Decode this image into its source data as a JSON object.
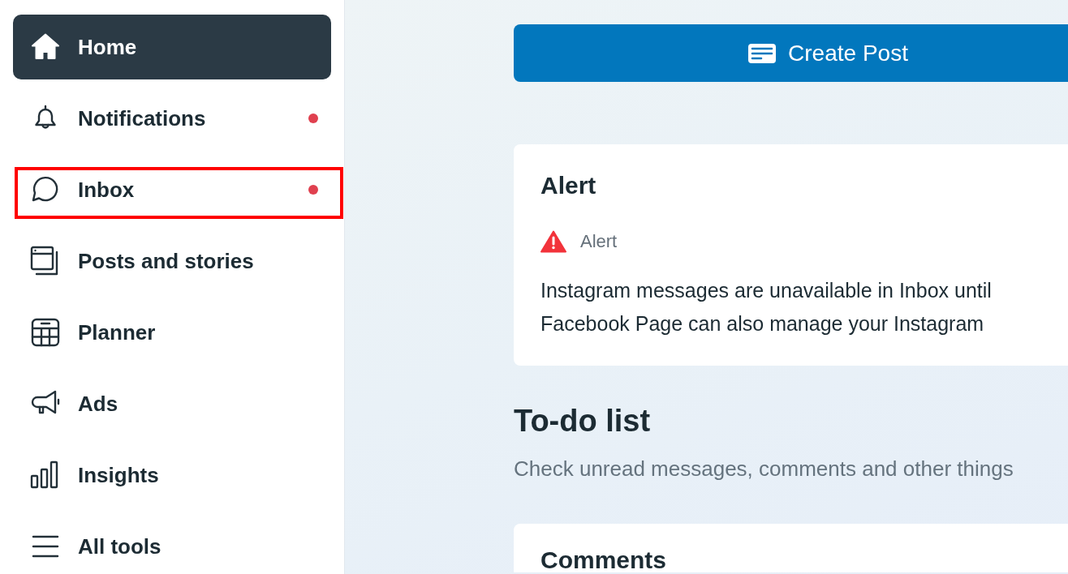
{
  "sidebar": {
    "items": [
      {
        "label": "Home",
        "selected": true,
        "unread": false,
        "highlighted": false
      },
      {
        "label": "Notifications",
        "selected": false,
        "unread": true,
        "highlighted": false
      },
      {
        "label": "Inbox",
        "selected": false,
        "unread": true,
        "highlighted": true
      },
      {
        "label": "Posts and stories",
        "selected": false,
        "unread": false,
        "highlighted": false
      },
      {
        "label": "Planner",
        "selected": false,
        "unread": false,
        "highlighted": false
      },
      {
        "label": "Ads",
        "selected": false,
        "unread": false,
        "highlighted": false
      },
      {
        "label": "Insights",
        "selected": false,
        "unread": false,
        "highlighted": false
      },
      {
        "label": "All tools",
        "selected": false,
        "unread": false,
        "highlighted": false
      }
    ]
  },
  "create_post_button": {
    "label": "Create Post"
  },
  "alert_card": {
    "title": "Alert",
    "alert_label": "Alert",
    "message_lines": [
      "Instagram messages are unavailable in Inbox until",
      "Facebook Page can also manage your Instagram"
    ]
  },
  "todo_list": {
    "title": "To-do list",
    "subtitle": "Check unread messages, comments and other things",
    "cards": [
      {
        "title": "Comments"
      }
    ]
  }
}
